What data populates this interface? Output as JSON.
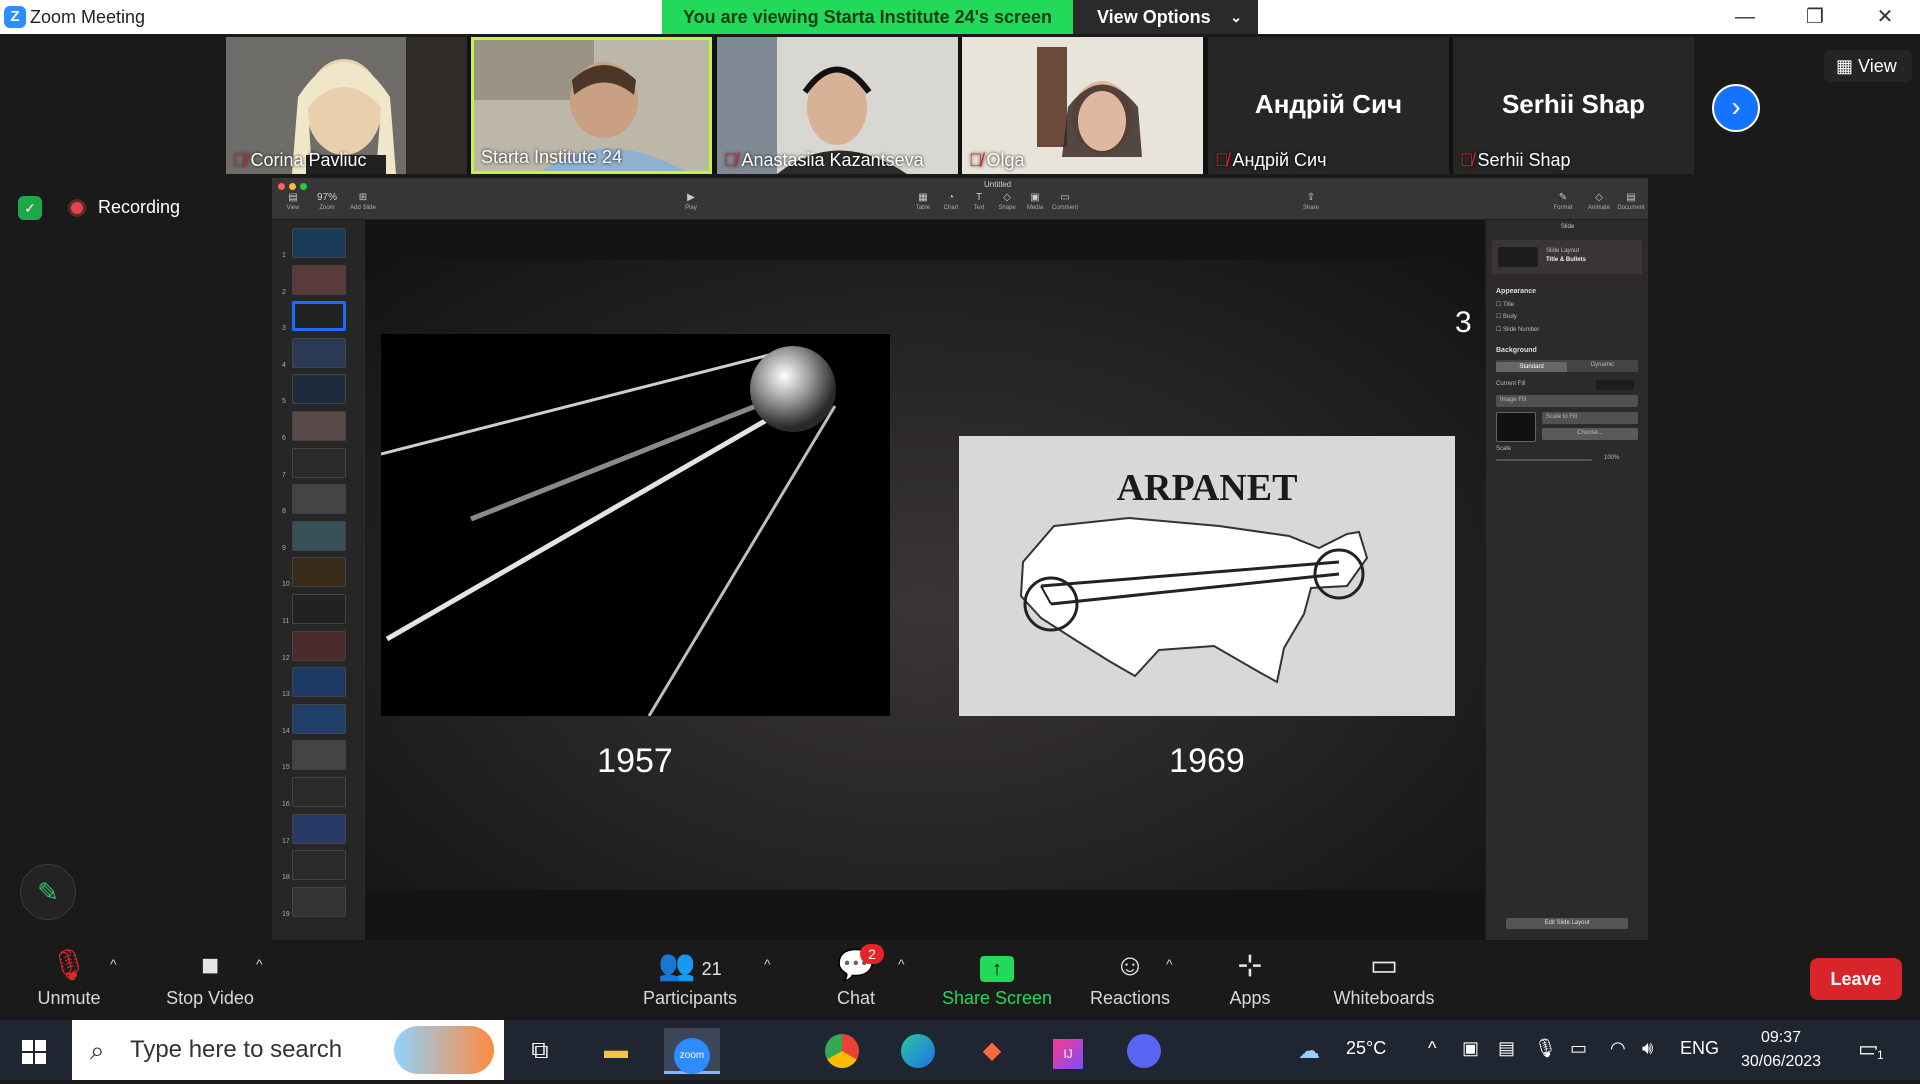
{
  "window": {
    "title": "Zoom Meeting",
    "logo_letter": "Z"
  },
  "share_banner": {
    "text": "You are viewing Starta Institute 24's screen",
    "view_options": "View Options"
  },
  "participants_strip": [
    {
      "name": "Corina Pavliuc",
      "muted": true,
      "video": true
    },
    {
      "name": "Starta Institute 24",
      "muted": false,
      "video": true,
      "active": true
    },
    {
      "name": "Anastasiia Kazantseva",
      "muted": true,
      "video": true
    },
    {
      "name": "Olga",
      "muted": true,
      "video": true
    },
    {
      "name": "Андрій Сич",
      "display": "Андрій Сич",
      "muted": true,
      "video": false
    },
    {
      "name": "Serhii Shap",
      "display": "Serhii Shap",
      "muted": true,
      "video": false
    }
  ],
  "view_button": "View",
  "recording": {
    "label": "Recording"
  },
  "keynote": {
    "doc_title": "Untitled",
    "zoom": "97%",
    "toolbar": [
      "View",
      "Zoom",
      "Add Slide",
      "Play",
      "Table",
      "Chart",
      "Text",
      "Shape",
      "Media",
      "Comment",
      "Share",
      "Format",
      "Animate",
      "Document"
    ],
    "slide_numbers": [
      "1",
      "2",
      "3",
      "4",
      "5",
      "6",
      "7",
      "8",
      "9",
      "10",
      "11",
      "12",
      "13",
      "14",
      "15",
      "16",
      "17",
      "18",
      "19"
    ],
    "selected_slide": 3,
    "slide": {
      "number": "3",
      "left_caption": "1957",
      "right_caption": "1969",
      "right_image_title": "ARPANET"
    },
    "inspector": {
      "tab": "Slide",
      "layout_label": "Slide Layout",
      "layout_value": "Title & Bullets",
      "appearance": "Appearance",
      "checks": [
        "Title",
        "Body",
        "Slide Number"
      ],
      "background": "Background",
      "bg_options": [
        "Standard",
        "Dynamic"
      ],
      "current_fill": "Current Fill",
      "fill_type": "Image Fill",
      "scale_mode": "Scale to Fill",
      "choose": "Choose...",
      "scale": "Scale",
      "scale_value": "100%",
      "edit_layout": "Edit Slide Layout"
    }
  },
  "controls": {
    "unmute": "Unmute",
    "stop_video": "Stop Video",
    "participants": "Participants",
    "participants_count": "21",
    "chat": "Chat",
    "chat_badge": "2",
    "share_screen": "Share Screen",
    "reactions": "Reactions",
    "apps": "Apps",
    "whiteboards": "Whiteboards",
    "leave": "Leave"
  },
  "taskbar": {
    "search_placeholder": "Type here to search",
    "weather": "25°C",
    "language": "ENG",
    "time": "09:37",
    "date": "30/06/2023",
    "notifications": "1"
  },
  "colors": {
    "accent": "#2d8cff",
    "banner": "#23d95a",
    "leave": "#d9252a",
    "share": "#23d95a",
    "slide_select": "#1e6cff"
  }
}
